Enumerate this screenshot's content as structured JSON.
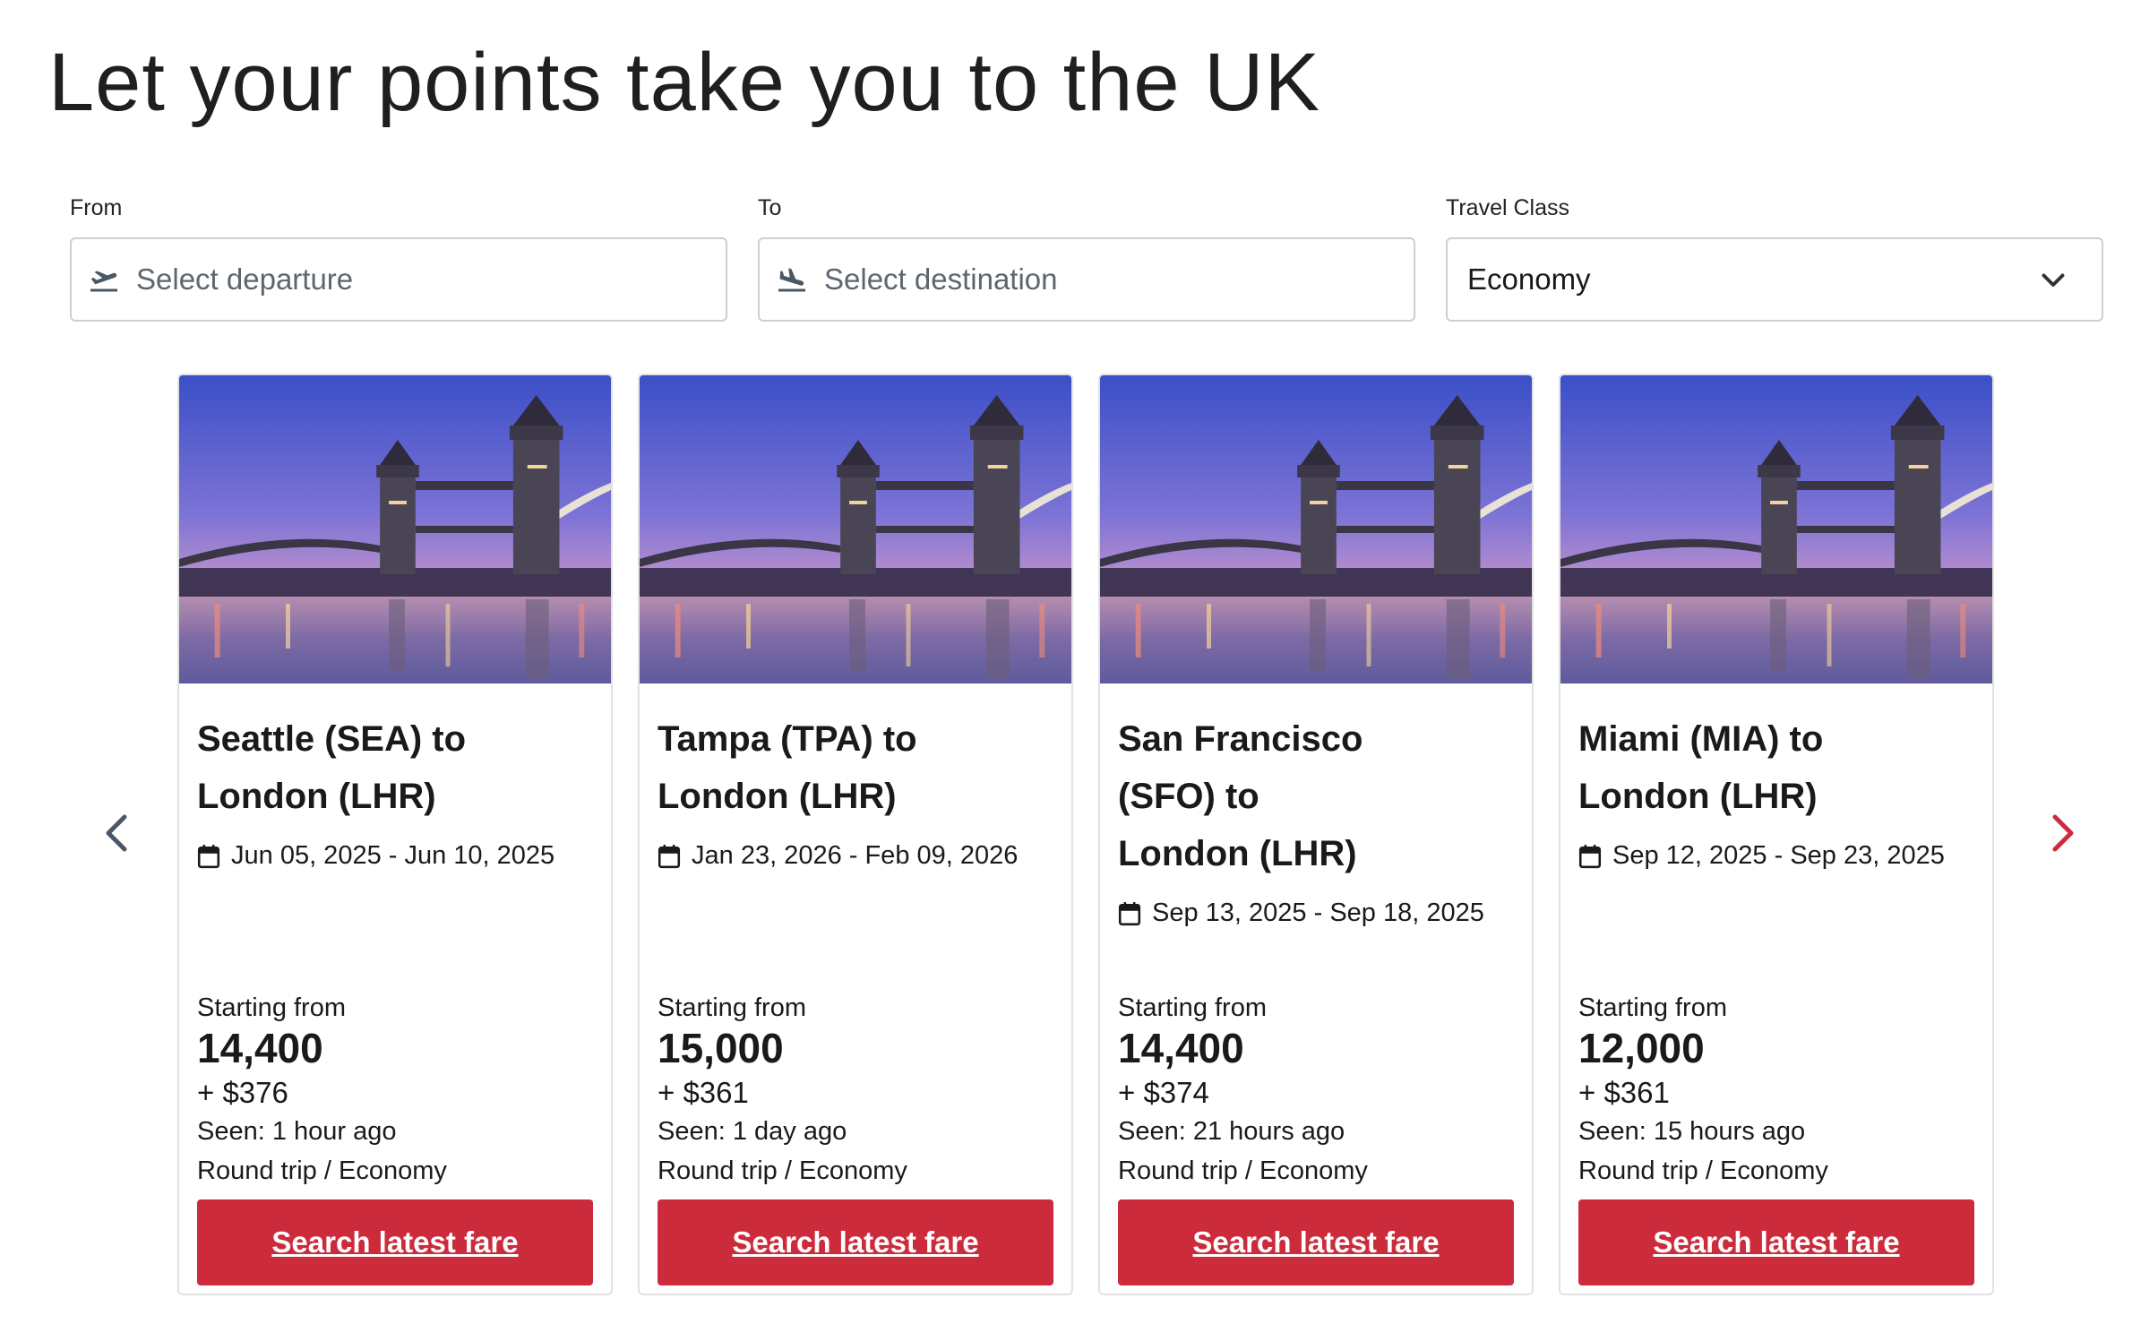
{
  "page": {
    "title": "Let your points take you to the UK"
  },
  "search": {
    "from_label": "From",
    "from_placeholder": "Select departure",
    "to_label": "To",
    "to_placeholder": "Select destination",
    "class_label": "Travel Class",
    "class_value": "Economy"
  },
  "colors": {
    "accent": "#cc2b3b",
    "arrow_left": "#4a5866",
    "arrow_right": "#cc2b3b"
  },
  "cards": [
    {
      "route_line1": "Seattle (SEA) to",
      "route_line2": "London (LHR)",
      "route_line3": "",
      "dates": "Jun 05, 2025 - Jun 10, 2025",
      "starting_label": "Starting from",
      "points": "14,400",
      "cash": "+ $376",
      "seen": "Seen: 1 hour ago",
      "trip": "Round trip / Economy",
      "cta": "Search latest fare"
    },
    {
      "route_line1": "Tampa (TPA) to",
      "route_line2": "London (LHR)",
      "route_line3": "",
      "dates": "Jan 23, 2026 - Feb 09, 2026",
      "starting_label": "Starting from",
      "points": "15,000",
      "cash": "+ $361",
      "seen": "Seen: 1 day ago",
      "trip": "Round trip / Economy",
      "cta": "Search latest fare"
    },
    {
      "route_line1": "San Francisco",
      "route_line2": "(SFO) to",
      "route_line3": "London (LHR)",
      "dates": "Sep 13, 2025 - Sep 18, 2025",
      "starting_label": "Starting from",
      "points": "14,400",
      "cash": "+ $374",
      "seen": "Seen: 21 hours ago",
      "trip": "Round trip / Economy",
      "cta": "Search latest fare"
    },
    {
      "route_line1": "Miami (MIA) to",
      "route_line2": "London (LHR)",
      "route_line3": "",
      "dates": "Sep 12, 2025 - Sep 23, 2025",
      "starting_label": "Starting from",
      "points": "12,000",
      "cash": "+ $361",
      "seen": "Seen: 15 hours ago",
      "trip": "Round trip / Economy",
      "cta": "Search latest fare"
    }
  ]
}
